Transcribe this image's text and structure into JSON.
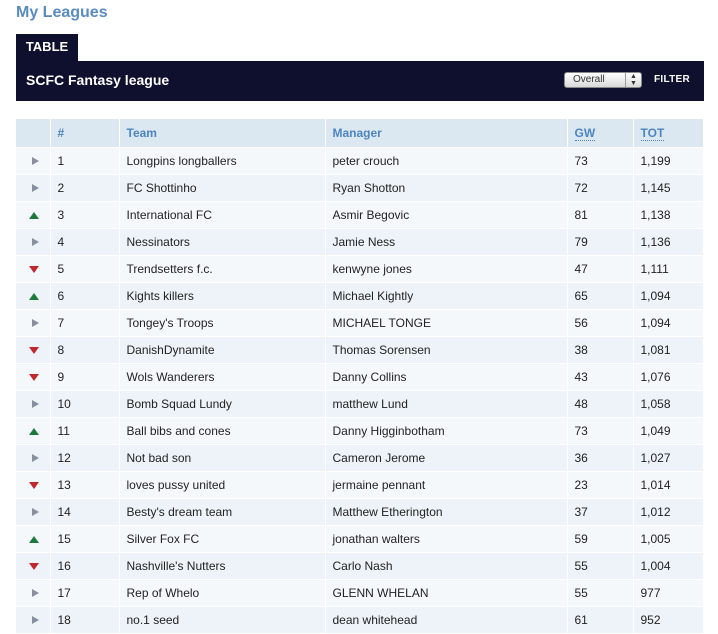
{
  "page_title": "My Leagues",
  "tab_label": "TABLE",
  "league_name": "SCFC Fantasy league",
  "filter_select_value": "Overall",
  "filter_button_label": "FILTER",
  "columns": {
    "rank": "#",
    "team": "Team",
    "manager": "Manager",
    "gw": "GW",
    "tot": "TOT"
  },
  "colors": {
    "accent": "#5b8cbf",
    "header_bg": "#0f0f2e",
    "up": "#1e7a3c",
    "down": "#c1272d",
    "same": "#8a8fa0"
  },
  "rows": [
    {
      "movement": "same",
      "rank": "1",
      "team": "Longpins longballers",
      "manager": "peter crouch",
      "gw": "73",
      "tot": "1,199"
    },
    {
      "movement": "same",
      "rank": "2",
      "team": "FC Shottinho",
      "manager": "Ryan Shotton",
      "gw": "72",
      "tot": "1,145"
    },
    {
      "movement": "up",
      "rank": "3",
      "team": "International FC",
      "manager": "Asmir Begovic",
      "gw": "81",
      "tot": "1,138"
    },
    {
      "movement": "same",
      "rank": "4",
      "team": "Nessinators",
      "manager": "Jamie Ness",
      "gw": "79",
      "tot": "1,136"
    },
    {
      "movement": "down",
      "rank": "5",
      "team": "Trendsetters f.c.",
      "manager": "kenwyne jones",
      "gw": "47",
      "tot": "1,111"
    },
    {
      "movement": "up",
      "rank": "6",
      "team": "Kights killers",
      "manager": "Michael Kightly",
      "gw": "65",
      "tot": "1,094"
    },
    {
      "movement": "same",
      "rank": "7",
      "team": "Tongey's Troops",
      "manager": "MICHAEL TONGE",
      "gw": "56",
      "tot": "1,094"
    },
    {
      "movement": "down",
      "rank": "8",
      "team": "DanishDynamite",
      "manager": "Thomas Sorensen",
      "gw": "38",
      "tot": "1,081"
    },
    {
      "movement": "down",
      "rank": "9",
      "team": "Wols Wanderers",
      "manager": "Danny Collins",
      "gw": "43",
      "tot": "1,076"
    },
    {
      "movement": "same",
      "rank": "10",
      "team": "Bomb Squad Lundy",
      "manager": "matthew Lund",
      "gw": "48",
      "tot": "1,058"
    },
    {
      "movement": "up",
      "rank": "11",
      "team": "Ball bibs and cones",
      "manager": "Danny Higginbotham",
      "gw": "73",
      "tot": "1,049"
    },
    {
      "movement": "same",
      "rank": "12",
      "team": "Not bad son",
      "manager": "Cameron Jerome",
      "gw": "36",
      "tot": "1,027"
    },
    {
      "movement": "down",
      "rank": "13",
      "team": "loves pussy united",
      "manager": "jermaine pennant",
      "gw": "23",
      "tot": "1,014"
    },
    {
      "movement": "same",
      "rank": "14",
      "team": "Besty's dream team",
      "manager": "Matthew Etherington",
      "gw": "37",
      "tot": "1,012"
    },
    {
      "movement": "up",
      "rank": "15",
      "team": "Silver Fox FC",
      "manager": "jonathan walters",
      "gw": "59",
      "tot": "1,005"
    },
    {
      "movement": "down",
      "rank": "16",
      "team": "Nashville's Nutters",
      "manager": "Carlo Nash",
      "gw": "55",
      "tot": "1,004"
    },
    {
      "movement": "same",
      "rank": "17",
      "team": "Rep of Whelo",
      "manager": "GLENN WHELAN",
      "gw": "55",
      "tot": "977"
    },
    {
      "movement": "same",
      "rank": "18",
      "team": "no.1 seed",
      "manager": "dean whitehead",
      "gw": "61",
      "tot": "952"
    }
  ]
}
